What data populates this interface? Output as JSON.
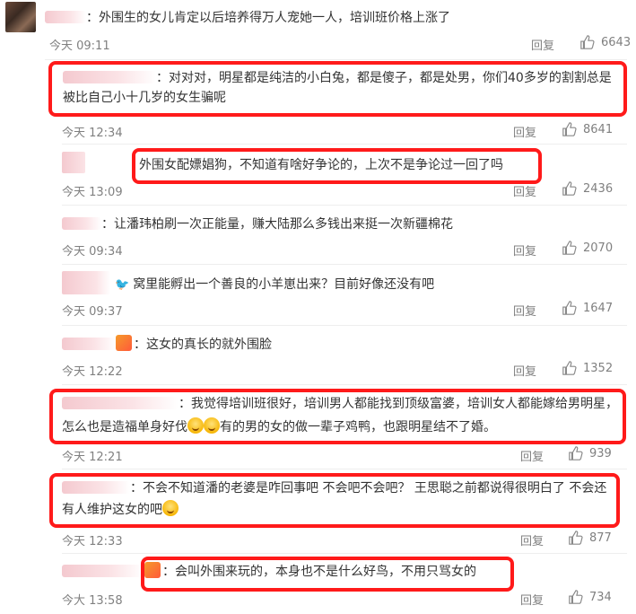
{
  "comments": [
    {
      "text": "：外围生的女儿肯定以后培养得万人宠她一人，培训班价格上涨了",
      "time": "今天 09:11",
      "reply": "回复",
      "likes": "6643"
    },
    {
      "text": "：对对对，明星都是纯洁的小白兔，都是傻子，都是处男，你们40多岁的割割总是被比自己小十几岁的女生骗呢",
      "time": "今天 12:34",
      "reply": "回复",
      "likes": "8641"
    },
    {
      "text": "外围女配嫖娼狗，不知道有啥好争论的，上次不是争论过一回了吗",
      "time": "今天 13:09",
      "reply": "回复",
      "likes": "2436"
    },
    {
      "text": "：让潘玮柏刷一次正能量，赚大陆那么多钱出来挺一次新疆棉花",
      "time": "今天 09:34",
      "reply": "回复",
      "likes": "2070"
    },
    {
      "text": "窝里能孵出一个善良的小羊崽出来？目前好像还没有吧",
      "time": "今天 09:37",
      "reply": "回复",
      "likes": "1647"
    },
    {
      "text": "：这女的真长的就外围脸",
      "time": "今天 12:22",
      "reply": "回复",
      "likes": "1352"
    },
    {
      "text_a": "：我觉得培训班很好，培训男人都能找到顶级富婆，培训女人都能嫁给男明星，怎么也是造福单身好伐",
      "text_b": "有的男的女的做一辈子鸡鸭，也跟明星结不了婚。",
      "time": "今天 12:21",
      "reply": "回复",
      "likes": "939"
    },
    {
      "text": "：不会不知道潘的老婆是咋回事吧 不会吧不会吧？ 王思聪之前都说得很明白了 不会还有人维护这女的吧",
      "time": "今天 12:33",
      "reply": "回复",
      "likes": "877"
    },
    {
      "text": "：会叫外围来玩的，本身也不是什么好鸟，不用只骂女的",
      "time": "今大 13:58",
      "reply": "回复",
      "likes": "734"
    }
  ],
  "icons": {
    "like": "thumbs-up-icon",
    "avatar": "user-avatar"
  },
  "colors": {
    "highlight_box": "#ff1a1a",
    "meta_text": "#808080"
  }
}
